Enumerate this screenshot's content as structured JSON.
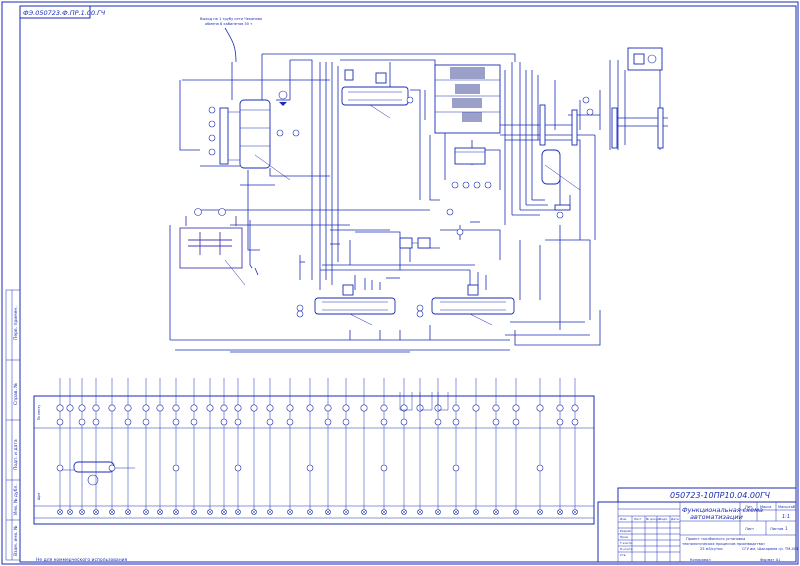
{
  "sheet": {
    "top_code": "ФЭ.050723.Ф.ПР.1.00.ГЧ",
    "vent_note_line1": "Выход на 1 трубу сети Чеканово",
    "vent_note_line2": "обмена 8 кабинетов 50 т",
    "side_label_top": "Перв. примен.",
    "side_label_mid": "Справ. №",
    "side_label_low": "Подп. и дата",
    "side_label_inv": "Инв. № дубл.",
    "side_label_vzam": "Взам. инв. №",
    "bottom_note": "Не для коммерческого использования",
    "copied_label": "Копировал",
    "format_label": "Формат  А1"
  },
  "title_block": {
    "doc_code": "050723-10ПР10.04.00ГЧ",
    "title_line1": "Функциональная схема",
    "title_line2": "автоматизации",
    "desc_line1": "Проект «колбасного установка",
    "desc_line2": "технологических процессов производства»",
    "desc_line3": "25 м3/сутки",
    "lit_label": "Лит.",
    "mass_label": "Масса",
    "scale_label": "Масштаб",
    "scale_value": "1:1",
    "sheet_label": "Лист",
    "sheets_label": "Листов",
    "sheets_value": "1",
    "org": "СГУ им. Шакарима гр. ТМ-401",
    "rows": [
      "Изм.",
      "Разраб.",
      "Пров.",
      "Т.контр.",
      "Н.контр.",
      "Утв."
    ],
    "row_headers": [
      "Изм.",
      "Лист",
      "№ докум.",
      "Подп.",
      "Дата"
    ]
  },
  "instrument_rows": {
    "row_labels": [
      "По месту",
      "Щит"
    ]
  }
}
